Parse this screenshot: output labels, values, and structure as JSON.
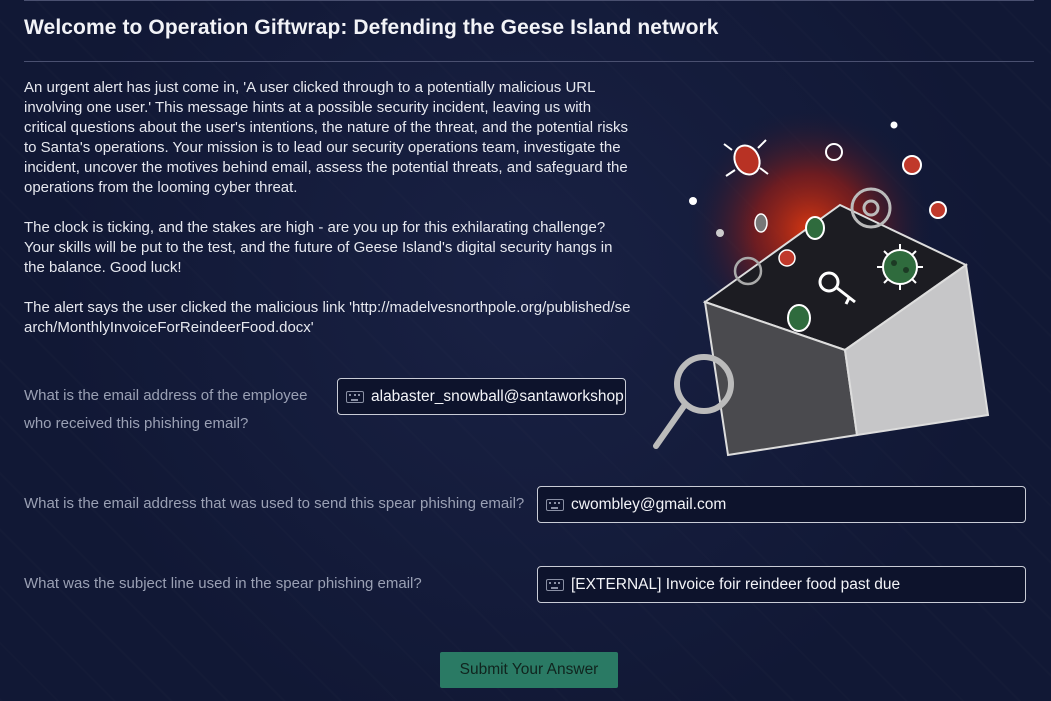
{
  "page": {
    "title": "Welcome to Operation Giftwrap: Defending the Geese Island network"
  },
  "intro": {
    "paragraph1": "An urgent alert has just come in, 'A user clicked through to a potentially malicious URL involving one user.' This message hints at a possible security incident, leaving us with critical questions about the user's intentions, the nature of the threat, and the potential risks to Santa's operations. Your mission is to lead our security operations team, investigate the incident, uncover the motives behind email, assess the potential threats, and safeguard the operations from the looming cyber threat.",
    "paragraph2": "The clock is ticking, and the stakes are high - are you up for this exhilarating challenge? Your skills will be put to the test, and the future of Geese Island's digital security hangs in the balance. Good luck!",
    "paragraph3": "The alert says the user clicked the malicious link 'http://madelvesnorthpole.org/published/search/MonthlyInvoiceForReindeerFood.docx'"
  },
  "questions": [
    {
      "label": "What is the email address of the employee who received this phishing email?",
      "value": "alabaster_snowball@santaworkshop"
    },
    {
      "label": "What is the email address that was used to send this spear phishing email?",
      "value": "cwombley@gmail.com"
    },
    {
      "label": "What was the subject line used in the spear phishing email?",
      "value": "[EXTERNAL] Invoice foir reindeer food past due"
    }
  ],
  "submit_label": "Submit Your Answer",
  "colors": {
    "background": "#111835",
    "submit": "#2a7a64",
    "field_border": "#c9ccd6"
  }
}
